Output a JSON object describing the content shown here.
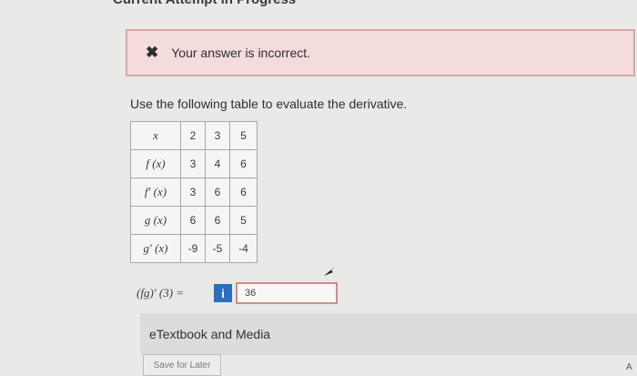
{
  "page": {
    "heading": "Current Attempt in Progress"
  },
  "alert": {
    "icon": "close-icon",
    "message": "Your answer is incorrect."
  },
  "question": {
    "prompt": "Use the following table to evaluate the derivative."
  },
  "table": {
    "rows": [
      {
        "label": "x",
        "values": [
          "2",
          "3",
          "5"
        ]
      },
      {
        "label": "f (x)",
        "values": [
          "3",
          "4",
          "6"
        ]
      },
      {
        "label": "f′ (x)",
        "values": [
          "3",
          "6",
          "6"
        ]
      },
      {
        "label": "g (x)",
        "values": [
          "6",
          "6",
          "5"
        ]
      },
      {
        "label": "g′ (x)",
        "values": [
          "-9",
          "-5",
          "-4"
        ]
      }
    ]
  },
  "answer": {
    "label": "(fg)′ (3) =",
    "info_label": "i",
    "value": "36"
  },
  "etextbook": {
    "label": "eTextbook and Media"
  },
  "save": {
    "label": "Save for Later"
  },
  "corner": {
    "text": "A"
  },
  "colors": {
    "alert_bg": "#f3dcdb",
    "alert_border": "#d9a8a7",
    "info_button": "#2a6fc2"
  }
}
